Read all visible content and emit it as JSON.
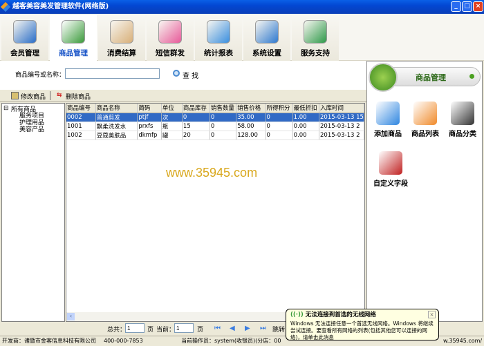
{
  "window": {
    "title": "越客美容美发管理软件(网络版)",
    "minimize": "_",
    "maximize": "□",
    "close": "×"
  },
  "tabs": [
    {
      "label": "会员管理",
      "color": "#2a6ec8"
    },
    {
      "label": "商品管理",
      "color": "#3a9a3a"
    },
    {
      "label": "消费结算",
      "color": "#d9b07a"
    },
    {
      "label": "短信群发",
      "color": "#e85a9a"
    },
    {
      "label": "统计报表",
      "color": "#3a8fe0"
    },
    {
      "label": "系统设置",
      "color": "#2f7ad0"
    },
    {
      "label": "服务支持",
      "color": "#2e9a4a"
    }
  ],
  "search": {
    "label": "商品编号或名称：",
    "value": "",
    "button": "查 找"
  },
  "toolbar": {
    "edit": "修改商品",
    "delete": "删除商品"
  },
  "tree": {
    "root": "所有商品",
    "children": [
      "服务项目",
      "护理用品",
      "美容产品"
    ]
  },
  "grid": {
    "columns": [
      "商品编号",
      "商品名称",
      "简码",
      "单位",
      "商品库存",
      "销售数量",
      "销售价格",
      "所得积分",
      "最低折扣",
      "入库时间"
    ],
    "rows": [
      [
        "0002",
        "普通剪发",
        "ptjf",
        "次",
        "0",
        "0",
        "35.00",
        "0",
        "1.00",
        "2015-03-13 15"
      ],
      [
        "1001",
        "飘柔洗发水",
        "prxfs",
        "瓶",
        "15",
        "0",
        "58.00",
        "0",
        "0.00",
        "2015-03-13 2"
      ],
      [
        "1002",
        "豆蔻美肤品",
        "dkmfp",
        "罐",
        "20",
        "0",
        "128.00",
        "0",
        "0.00",
        "2015-03-13 2"
      ]
    ]
  },
  "watermark": "www.35945.com",
  "right_panel": {
    "title": "商品管理",
    "buttons": [
      {
        "label": "添加商品",
        "color": "#2f86e0"
      },
      {
        "label": "商品列表",
        "color": "#f08a2a"
      },
      {
        "label": "商品分类",
        "color": "#333333"
      },
      {
        "label": "自定义字段",
        "color": "#c02020"
      }
    ]
  },
  "pager": {
    "total_label": "总共：",
    "total": "1",
    "page_unit": "页",
    "current_label": "当前：",
    "current": "1",
    "page_unit2": "页",
    "jump_label": "跳转"
  },
  "status": {
    "developer": "开发商：诸暨市金客信息科技有限公司",
    "phone": "400-000-7853",
    "operator": "当前操作员：system(收银员)(分店：00",
    "url": "w.35945.com/"
  },
  "balloon": {
    "title": "无法连接到首选的无线网络",
    "body": "Windows 无法连接任意一个首选无线网络。Windows 将继续尝试连接。要查看所有网络的列表(包括其他您可以连接的网络)，请单击此消息",
    "close": "×"
  }
}
